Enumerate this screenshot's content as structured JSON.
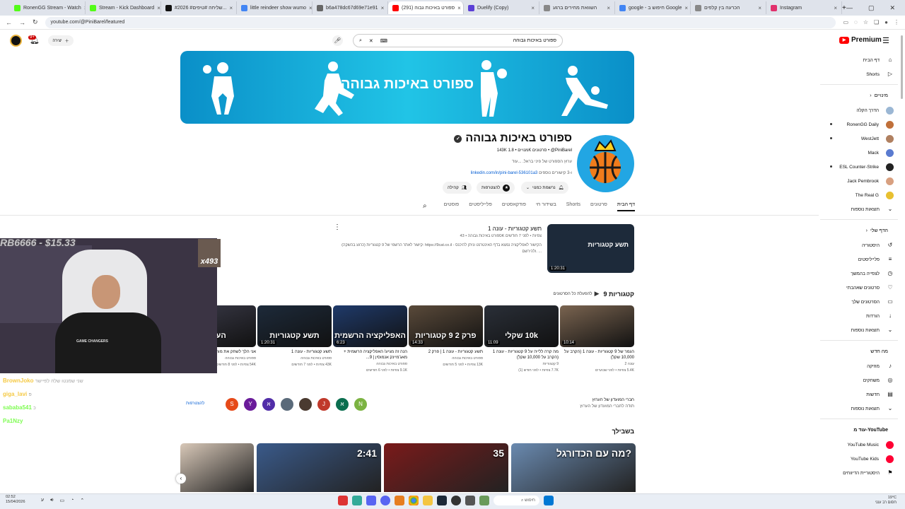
{
  "browser": {
    "tabs": [
      {
        "label": "RonenGG Stream - Watch",
        "color": "#53fc18"
      },
      {
        "label": "Stream - Kick Dashboard",
        "color": "#53fc18"
      },
      {
        "label": "#2026 #שליחה #טיפים...",
        "color": "#111111"
      },
      {
        "label": "little reindeer show wumo",
        "color": "#4285f4"
      },
      {
        "label": "b6a478dc67d69e71e91",
        "color": "#666666"
      },
      {
        "label": "(291) ספורט באיכות גבוה",
        "color": "#ff0000",
        "active": true
      },
      {
        "label": "Duelify (Copy)",
        "color": "#5b3fd6"
      },
      {
        "label": "השוואת מחירים ברגע",
        "color": "#888888"
      },
      {
        "label": "google - חיפוש ב Google",
        "color": "#4285f4"
      },
      {
        "label": "הכרעה בין קלפים",
        "color": "#888888"
      },
      {
        "label": "Instagram",
        "color": "#e1306c"
      }
    ],
    "url": "youtube.com/@PiniBarel/featured"
  },
  "youtube": {
    "notifications": "9+",
    "create_label": "יצירה",
    "search_query": "ספורט באיכות גבוהה",
    "logo_label": "Premium"
  },
  "sidebar": {
    "main": [
      {
        "label": "דף הבית",
        "icon": "home-icon",
        "glyph": "⌂"
      },
      {
        "label": "Shorts",
        "icon": "shorts-icon",
        "glyph": "▷"
      }
    ],
    "subs_header": "מינויים",
    "subs": [
      {
        "label": "הדרך הקלה",
        "color": "#9bb7d4"
      },
      {
        "label": "RonenGG Daily",
        "color": "#c0703a"
      },
      {
        "label": "WestJett",
        "color": "#b08060"
      },
      {
        "label": "Mack",
        "color": "#5a7bd0"
      },
      {
        "label": "ESL Counter-Strike",
        "color": "#222222"
      },
      {
        "label": "Jack Pembrook",
        "color": "#d8a080"
      },
      {
        "label": "The Real G",
        "color": "#e8c030"
      },
      {
        "label": "תוצאות נוספות",
        "color": ""
      }
    ],
    "you_header": "הדף שלי",
    "you": [
      {
        "label": "היסטוריה",
        "glyph": "↺"
      },
      {
        "label": "פלייליסטים",
        "glyph": "≡"
      },
      {
        "label": "לצפייה בהמשך",
        "glyph": "◷"
      },
      {
        "label": "סרטונים שאהבתי",
        "glyph": "♡"
      },
      {
        "label": "הסרטונים שלך",
        "glyph": "▭"
      },
      {
        "label": "הורדות",
        "glyph": "↓"
      },
      {
        "label": "תוצאות נוספות",
        "glyph": "⌄"
      }
    ],
    "explore_header": "מה חדש",
    "explore": [
      {
        "label": "מוזיקה",
        "glyph": "♪"
      },
      {
        "label": "משחקים",
        "glyph": "◎"
      },
      {
        "label": "חדשות",
        "glyph": "▤"
      },
      {
        "label": "תוצאות נוספות",
        "glyph": "⌄"
      }
    ],
    "more_header": "עוד מ-YouTube",
    "more": [
      {
        "label": "YouTube Music",
        "color": "#ff0033"
      },
      {
        "label": "YouTube Kids",
        "color": "#ff0033"
      },
      {
        "label": "היסטוריית הדיווחים",
        "color": ""
      }
    ]
  },
  "channel": {
    "banner_text": "ספורט באיכות גבוהה",
    "name": "ספורט באיכות גבוהה",
    "handle": "@PiniBarel",
    "stats": "143K מנויים • 1.8K סרטונים",
    "description": "ערוץ הספורט של פיני בראל. ...עוד",
    "link": "linkedin.com/in/pini-barel-536101a3",
    "link_more": "ו-3 קישורים נוספים",
    "buttons": {
      "subscribed": "נרשמת כמנוי",
      "join": "להצטרפות",
      "community": "קהילה"
    },
    "tabs": [
      "דף הבית",
      "סרטונים",
      "Shorts",
      "בשידור חי",
      "פודקאסטים",
      "פלייליסטים",
      "פוסטים"
    ]
  },
  "featured": {
    "title": "תשע קטגוריות - עונה 1",
    "meta": "ספורט באיכות גבוהה • 43K צפיות • לפני 7 חודשים",
    "desc": "קישור לאתר הרשמי של 9 קטגוריות (כרגע בהשקה): https://9cat.co.il - הקישור לאפליקציה נמצא בדף האינטרנט וניתן להיכנס ולהירשם. ...",
    "duration": "1:20:31",
    "thumb_text": "תשע קטגוריות"
  },
  "playlist": {
    "title": "9 קטגוריות",
    "play_all": "להפעלת כל הסרטונים",
    "videos": [
      {
        "title": "הגמר של 9 קטגוריות - עונה 1 (הקרב על 10,000 שקל)",
        "channel": "עונה 2",
        "meta": "5.4K צפיות • לפני שבועיים",
        "duration": "10:14",
        "thumb": "",
        "color": "#7a6450"
      },
      {
        "title": "מה קרה ללייה על 9 קטגוריות - עונה 1 (הקרב על 10,000 שקל)",
        "channel": "9 קטגוריות",
        "meta": "7.7K צפיות • לפני חודש (1)",
        "duration": "11:09",
        "thumb": "10k שקלי",
        "color": "#2a2f38"
      },
      {
        "title": "תשע קטגוריות - עונה 1 | פרק 2",
        "channel": "ספורט באיכות גבוהה",
        "meta": "13K צפיות • לפני 5 חודשים",
        "duration": "14:33",
        "thumb": "פרק 2 9 קטגוריות",
        "color": "#5a4a3a"
      },
      {
        "title": "הנה זה מגיע! האפליקציה הרשמית + מאג'מיינק אנמוסין | 9...",
        "channel": "ספורט באיכות גבוהה",
        "meta": "9.1K צפיות • לפני 6 חודשים",
        "duration": "6:23",
        "thumb": "האפליקציה הרשמית",
        "color": "#1f3a6a"
      },
      {
        "title": "תשע קטגוריות - עונה 1",
        "channel": "ספורט באיכות גבוהה",
        "meta": "43K צפיות • לפני 7 חודשים",
        "duration": "1:20:31",
        "thumb": "תשע קטגוריות",
        "color": "#1d2a3a"
      },
      {
        "title": "אני הלך לשחק את מורית בישראל מחוץ 3",
        "channel": "ספורט באיכות גבוהה",
        "meta": "54K צפיות • לפני 8 חודשים",
        "duration": "",
        "thumb": "הער",
        "color": "#3a3a48"
      }
    ]
  },
  "members": {
    "line1": "חברי המועדון של הערוץ",
    "line2": "תודה לחברי המועדון של הערוץ",
    "join": "להצטרפות",
    "circles": [
      {
        "letter": "N",
        "color": "#7cb342"
      },
      {
        "letter": "א",
        "color": "#0b6e4f"
      },
      {
        "letter": "J",
        "color": "#c0392b"
      },
      {
        "letter": "",
        "color": "#4a3a30"
      },
      {
        "letter": "",
        "color": "#5a6a7a"
      },
      {
        "letter": "א",
        "color": "#512da8"
      },
      {
        "letter": "Y",
        "color": "#6a1b9a"
      },
      {
        "letter": "S",
        "color": "#e64a19"
      }
    ]
  },
  "for_you": {
    "title": "בשבילך",
    "cards": [
      {
        "text": "",
        "color": "#d8c8b8"
      },
      {
        "text": "2:41",
        "color": "#3a5a8a"
      },
      {
        "text": "35",
        "color": "#7a1a1a"
      },
      {
        "text": "מה עם הכדורגל?",
        "color": "#6a8ab0"
      }
    ]
  },
  "stream_overlay": {
    "donation": "RB6666 - $15.33",
    "multiplier": "x493",
    "shirt": "GAME CHANGERS",
    "chat": [
      {
        "name": "BrownJoko",
        "msg": "שני שמנטו שלה לפיישר",
        "color": "#f2b705"
      },
      {
        "name": "giga_lavi",
        "msg": "פ",
        "color": "#f2b705"
      },
      {
        "name": "sababa541",
        "msg": "כ",
        "color": "#53fc18"
      },
      {
        "name": "Pa1Nzy",
        "msg": "",
        "color": "#53fc18"
      }
    ]
  },
  "taskbar": {
    "time": "02:52",
    "date": "15/04/2026",
    "weather": "19°C",
    "weather_desc": "חסום רב ענני"
  }
}
